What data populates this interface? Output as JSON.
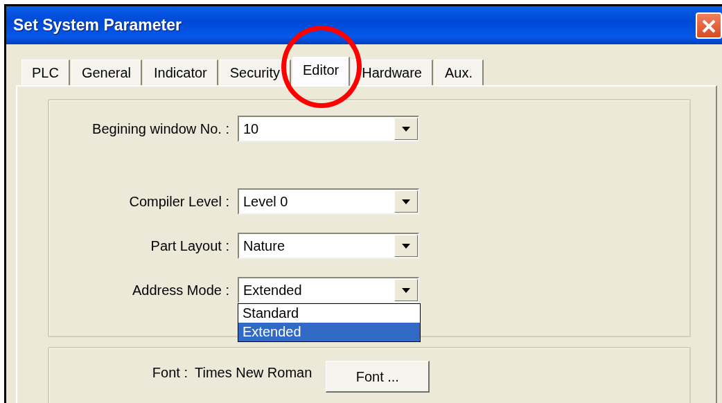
{
  "window": {
    "title": "Set System Parameter"
  },
  "tabs": [
    {
      "label": "PLC",
      "selected": false
    },
    {
      "label": "General",
      "selected": false
    },
    {
      "label": "Indicator",
      "selected": false
    },
    {
      "label": "Security",
      "selected": false
    },
    {
      "label": "Editor",
      "selected": true
    },
    {
      "label": "Hardware",
      "selected": false
    },
    {
      "label": "Aux.",
      "selected": false
    }
  ],
  "field_groups": [
    [
      {
        "label": "Begining window No. :",
        "value": "10"
      }
    ],
    [
      {
        "label": "Compiler Level :",
        "value": "Level 0"
      },
      {
        "label": "Part Layout :",
        "value": "Nature"
      },
      {
        "label": "Address Mode :",
        "value": "Extended",
        "options": [
          {
            "label": "Standard",
            "selected": false
          },
          {
            "label": "Extended",
            "selected": true
          }
        ]
      }
    ]
  ],
  "font": {
    "label": "Font :",
    "value": "Times New Roman",
    "button": "Font ..."
  }
}
